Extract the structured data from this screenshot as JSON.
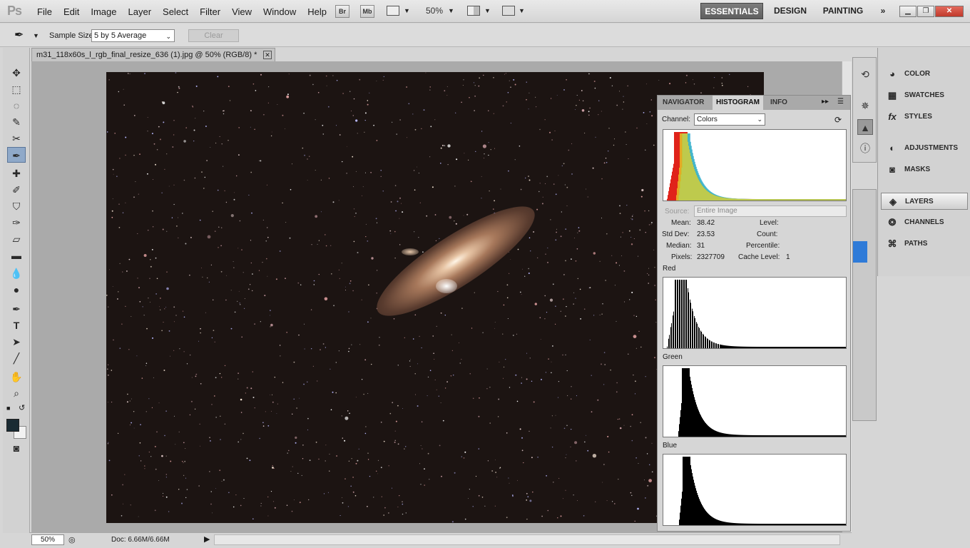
{
  "app": {
    "logo": "Ps"
  },
  "menu": [
    "File",
    "Edit",
    "Image",
    "Layer",
    "Select",
    "Filter",
    "View",
    "Window",
    "Help"
  ],
  "app_bar": {
    "bridge": "Br",
    "mini_bridge": "Mb",
    "zoom": "50%"
  },
  "workspaces": {
    "essentials": "ESSENTIALS",
    "design": "DESIGN",
    "painting": "PAINTING",
    "more": "»"
  },
  "options": {
    "sample_size_label": "Sample Size:",
    "sample_size_value": "5 by 5 Average",
    "clear_label": "Clear"
  },
  "document": {
    "tab_title": "m31_118x60s_l_rgb_final_resize_636 (1).jpg @ 50% (RGB/8) *",
    "zoom": "50%",
    "doc_info": "Doc: 6.66M/6.66M"
  },
  "histogram": {
    "tabs": [
      "NAVIGATOR",
      "HISTOGRAM",
      "INFO"
    ],
    "channel_label": "Channel:",
    "channel_value": "Colors",
    "source_label": "Source:",
    "source_value": "Entire Image",
    "stats": {
      "mean_label": "Mean:",
      "mean": "38.42",
      "std_label": "Std Dev:",
      "std": "23.53",
      "median_label": "Median:",
      "median": "31",
      "pixels_label": "Pixels:",
      "pixels": "2327709",
      "level_label": "Level:",
      "count_label": "Count:",
      "percentile_label": "Percentile:",
      "cache_label": "Cache Level:",
      "cache": "1"
    },
    "channels": [
      "Red",
      "Green",
      "Blue"
    ]
  },
  "side_panels": [
    {
      "label": "COLOR",
      "icon": "color-icon"
    },
    {
      "label": "SWATCHES",
      "icon": "swatches-icon"
    },
    {
      "label": "STYLES",
      "icon": "styles-icon"
    },
    {
      "label": "ADJUSTMENTS",
      "icon": "adjustments-icon"
    },
    {
      "label": "MASKS",
      "icon": "masks-icon"
    },
    {
      "label": "LAYERS",
      "icon": "layers-icon"
    },
    {
      "label": "CHANNELS",
      "icon": "channels-icon"
    },
    {
      "label": "PATHS",
      "icon": "paths-icon"
    }
  ],
  "colors": {
    "foreground": "#1a2b33",
    "background": "#f2f2f2",
    "accent": "#2f7bd8"
  }
}
